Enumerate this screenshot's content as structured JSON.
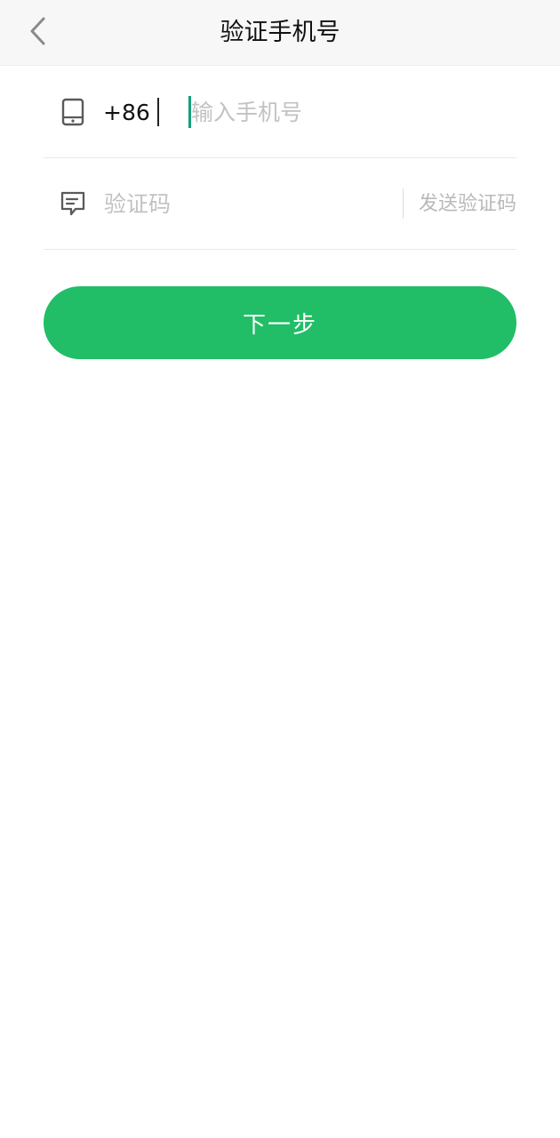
{
  "header": {
    "title": "验证手机号",
    "back_icon": "chevron-left-icon"
  },
  "phone_row": {
    "icon": "phone-icon",
    "country_code": "+86",
    "placeholder": "输入手机号",
    "value": ""
  },
  "code_row": {
    "icon": "message-icon",
    "placeholder": "验证码",
    "value": "",
    "send_label": "发送验证码"
  },
  "next_button": {
    "label": "下一步"
  },
  "colors": {
    "accent": "#21bd67",
    "caret": "#12a07a",
    "placeholder": "#c2c2c2"
  }
}
